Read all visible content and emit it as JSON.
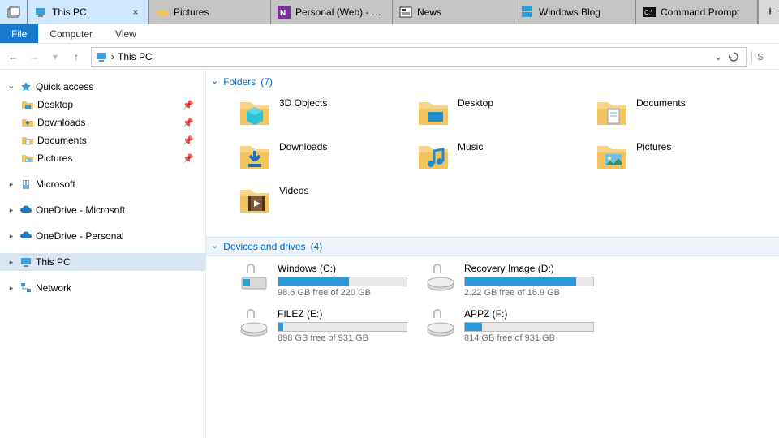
{
  "tabs": [
    {
      "label": "This PC",
      "active": true,
      "icon": "pc"
    },
    {
      "label": "Pictures",
      "icon": "folder"
    },
    {
      "label": "Personal (Web) - One",
      "icon": "onenote"
    },
    {
      "label": "News",
      "icon": "news"
    },
    {
      "label": "Windows Blog",
      "icon": "windows"
    },
    {
      "label": "Command Prompt",
      "icon": "cmd"
    }
  ],
  "tab_new": "+",
  "tab_active_close": "×",
  "menubar": {
    "file": "File",
    "computer": "Computer",
    "view": "View"
  },
  "nav": {
    "back": "←",
    "forward": "→",
    "up": "↑",
    "refresh": "↻",
    "search_hint": "S"
  },
  "breadcrumb": {
    "sep": "›",
    "location": "This PC",
    "drop": "⌄"
  },
  "sidebar": {
    "quick_access": "Quick access",
    "quick_items": [
      {
        "label": "Desktop",
        "icon": "desktop"
      },
      {
        "label": "Downloads",
        "icon": "downloads"
      },
      {
        "label": "Documents",
        "icon": "documents"
      },
      {
        "label": "Pictures",
        "icon": "pictures"
      }
    ],
    "microsoft": "Microsoft",
    "onedrive_ms": "OneDrive - Microsoft",
    "onedrive_p": "OneDrive - Personal",
    "this_pc": "This PC",
    "network": "Network"
  },
  "content": {
    "folders_header": "Folders",
    "folders_count": "(7)",
    "folders": [
      {
        "label": "3D Objects",
        "icon": "3d"
      },
      {
        "label": "Desktop",
        "icon": "desktop"
      },
      {
        "label": "Documents",
        "icon": "documents"
      },
      {
        "label": "Downloads",
        "icon": "downloads"
      },
      {
        "label": "Music",
        "icon": "music"
      },
      {
        "label": "Pictures",
        "icon": "pictures"
      },
      {
        "label": "Videos",
        "icon": "videos"
      }
    ],
    "drives_header": "Devices and drives",
    "drives_count": "(4)",
    "drives": [
      {
        "name": "Windows (C:)",
        "free": "98.6 GB free of 220 GB",
        "fill": 55,
        "icon": "win-drive"
      },
      {
        "name": "Recovery Image (D:)",
        "free": "2.22 GB free of 16.9 GB",
        "fill": 87,
        "icon": "usb-drive"
      },
      {
        "name": "FILEZ (E:)",
        "free": "898 GB free of 931 GB",
        "fill": 4,
        "icon": "usb-drive"
      },
      {
        "name": "APPZ (F:)",
        "free": "814 GB free of 931 GB",
        "fill": 13,
        "icon": "usb-drive"
      }
    ]
  }
}
